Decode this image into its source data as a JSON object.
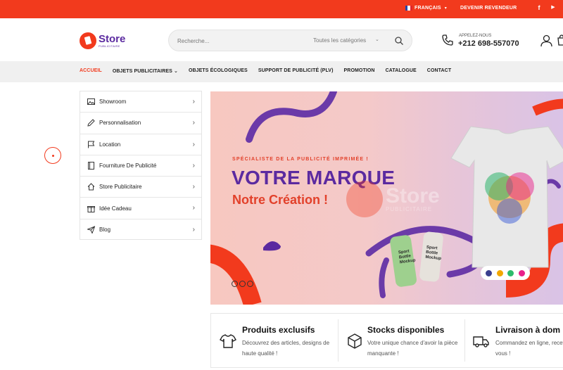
{
  "topbar": {
    "language": "FRANÇAIS",
    "reseller": "DEVENIR REVENDEUR",
    "social": [
      {
        "icon": "facebook-icon",
        "glyph": "f"
      },
      {
        "icon": "youtube-icon",
        "glyph": "▶"
      },
      {
        "icon": "instagram-icon",
        "glyph": "◎"
      }
    ]
  },
  "brand": {
    "name": "Store",
    "tagline": "PUBLICITAIRE",
    "accent": "#f23a1d",
    "purple": "#5b2aa0"
  },
  "search": {
    "placeholder": "Recherche...",
    "category": "Toutes les catégories"
  },
  "contact": {
    "label": "APPELEZ-NOUS",
    "phone": "+212 698-557070"
  },
  "nav": [
    "ACCUEIL",
    "OBJETS PUBLICITAIRES",
    "OBJETS ÉCOLOGIQUES",
    "SUPPORT DE PUBLICITÉ (PLV)",
    "PROMOTION",
    "CATALOGUE",
    "CONTACT"
  ],
  "sidebar": [
    {
      "label": "Showroom",
      "icon": "image-icon"
    },
    {
      "label": "Personnalisation",
      "icon": "pencil-icon"
    },
    {
      "label": "Location",
      "icon": "flag-icon"
    },
    {
      "label": "Fourniture De Publicité",
      "icon": "notebook-icon"
    },
    {
      "label": "Store Publicitaire",
      "icon": "home-icon"
    },
    {
      "label": "Idée Cadeau",
      "icon": "gift-icon"
    },
    {
      "label": "Blog",
      "icon": "send-icon"
    }
  ],
  "banner": {
    "tagline": "SPÉCIALISTE DE LA PUBLICITÉ IMPRIMÉE !",
    "headline": "VOTRE MARQUE",
    "subhead": "Notre Création !",
    "watermark": {
      "name": "Store",
      "tagline": "PUBLICITAIRE"
    },
    "bottle_text": [
      "Sport",
      "Bottle",
      "Mockup"
    ],
    "swatches": [
      "#3b3f8f",
      "#f2a700",
      "#2dbb6b",
      "#e8208a"
    ],
    "slides": 3
  },
  "features": [
    {
      "title": "Produits exclusifs",
      "desc": "Découvrez des articles, designs de haute qualité !",
      "icon": "tshirt-icon"
    },
    {
      "title": "Stocks disponibles",
      "desc": "Votre unique chance d'avoir la pièce manquante !",
      "icon": "box-icon"
    },
    {
      "title": "Livraison à dom",
      "desc": "Commandez en ligne, recevez chez vous !",
      "icon": "truck-icon"
    }
  ]
}
